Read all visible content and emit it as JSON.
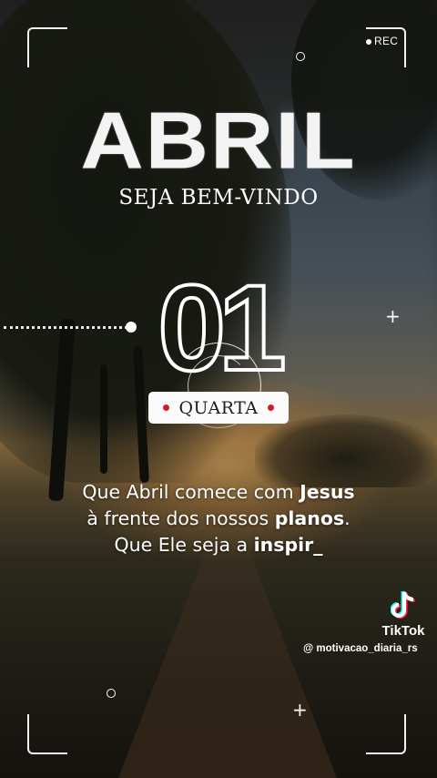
{
  "recording": {
    "label": "REC"
  },
  "header": {
    "month": "ABRIL",
    "greeting": "SEJA BEM-VINDO"
  },
  "date": {
    "day": "01",
    "weekday": "QUARTA"
  },
  "quote": {
    "line1_a": "Que Abril comece com ",
    "line1_b": "Jesus",
    "line2_a": "à frente dos nossos ",
    "line2_b": "planos",
    "line2_c": ".",
    "line3_a": "Que Ele seja a ",
    "line3_b": "inspir_"
  },
  "watermark": {
    "brand": "TikTok",
    "handle": "@ motivacao_diaria_rs"
  },
  "colors": {
    "accent_red": "#d11b2a",
    "text": "#ffffff"
  },
  "icons": [
    "rec-dot-icon",
    "tiktok-logo-icon",
    "plus-icon",
    "ring-icon"
  ]
}
